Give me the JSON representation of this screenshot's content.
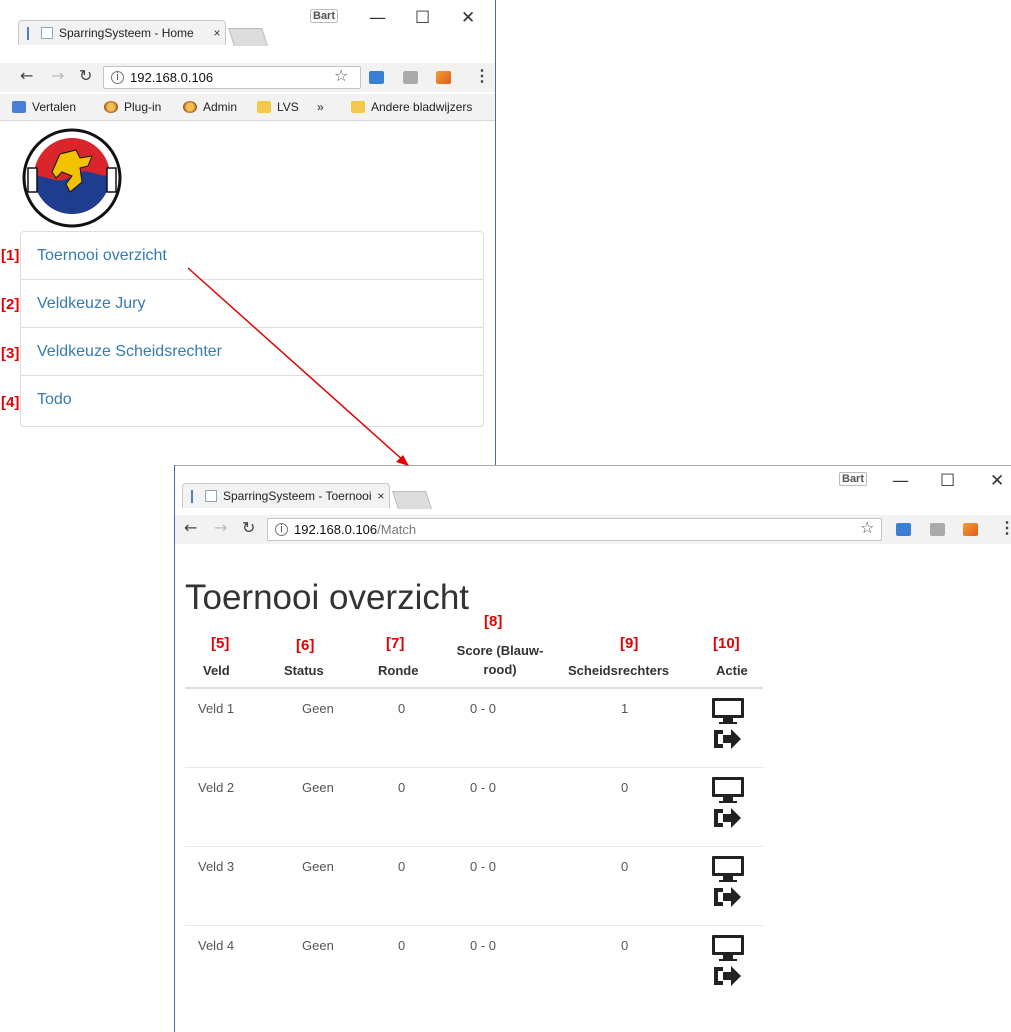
{
  "window1": {
    "tab_title": "SparringSysteem - Home",
    "tab_close": "×",
    "user_badge": "Bart",
    "min": "—",
    "max": "☐",
    "close": "✕",
    "url_host": "192.168.0.106",
    "url_path": "",
    "bookmarks": [
      {
        "label": "Vertalen",
        "icon": "translate-icon"
      },
      {
        "label": "Plug-in",
        "icon": "plugin-icon"
      },
      {
        "label": "Admin",
        "icon": "plugin-icon"
      },
      {
        "label": "LVS",
        "icon": "folder-icon"
      },
      {
        "label": "»",
        "icon": ""
      },
      {
        "label": "Andere bladwijzers",
        "icon": "folder-icon"
      }
    ],
    "menu": [
      {
        "marker": "[1]",
        "label": "Toernooi overzicht"
      },
      {
        "marker": "[2]",
        "label": "Veldkeuze Jury"
      },
      {
        "marker": "[3]",
        "label": "Veldkeuze Scheidsrechter"
      },
      {
        "marker": "[4]",
        "label": "Todo"
      }
    ]
  },
  "window2": {
    "tab_title": "SparringSysteem - Toernooi",
    "tab_close": "×",
    "user_badge": "Bart",
    "min": "—",
    "max": "☐",
    "close": "✕",
    "url_host": "192.168.0.106",
    "url_path": "/Match",
    "heading": "Toernooi overzicht",
    "columns": [
      {
        "marker": "[5]",
        "label": "Veld"
      },
      {
        "marker": "[6]",
        "label": "Status"
      },
      {
        "marker": "[7]",
        "label": "Ronde"
      },
      {
        "marker": "[8]",
        "label": "Score (Blauw-rood)"
      },
      {
        "marker": "[9]",
        "label": "Scheidsrechters"
      },
      {
        "marker": "[10]",
        "label": "Actie"
      }
    ],
    "col8_line1": "Score (Blauw-",
    "col8_line2": "rood)",
    "rows": [
      {
        "veld": "Veld 1",
        "status": "Geen",
        "ronde": "0",
        "score": "0 - 0",
        "scheidsrechters": "1"
      },
      {
        "veld": "Veld 2",
        "status": "Geen",
        "ronde": "0",
        "score": "0 - 0",
        "scheidsrechters": "0"
      },
      {
        "veld": "Veld 3",
        "status": "Geen",
        "ronde": "0",
        "score": "0 - 0",
        "scheidsrechters": "0"
      },
      {
        "veld": "Veld 4",
        "status": "Geen",
        "ronde": "0",
        "score": "0 - 0",
        "scheidsrechters": "0"
      }
    ],
    "action_icons": [
      "monitor-icon",
      "exit-icon"
    ]
  },
  "colors": {
    "link": "#337ab7",
    "marker": "#e30000",
    "arrow": "#e30000",
    "logo_red": "#d9262c",
    "logo_blue": "#1f3d8f",
    "logo_yellow": "#f2c200"
  }
}
